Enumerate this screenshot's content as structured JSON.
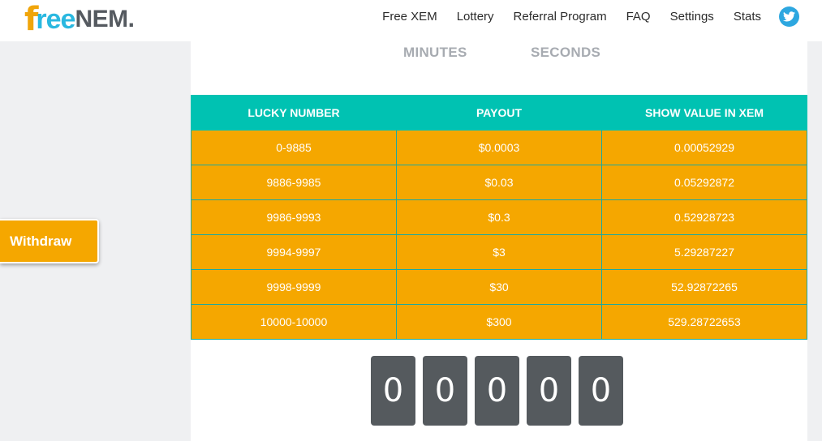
{
  "header": {
    "logo": {
      "f": "f",
      "ree": "ree",
      "nem": "NEM",
      "dot": "."
    },
    "nav": [
      {
        "label": "Free XEM"
      },
      {
        "label": "Lottery"
      },
      {
        "label": "Referral Program"
      },
      {
        "label": "FAQ"
      },
      {
        "label": "Settings"
      },
      {
        "label": "Stats"
      }
    ],
    "social_icon": "twitter-icon"
  },
  "timer": {
    "minutes_label": "MINUTES",
    "seconds_label": "SECONDS"
  },
  "payout_table": {
    "headers": [
      "LUCKY NUMBER",
      "PAYOUT",
      "SHOW VALUE IN XEM"
    ],
    "rows": [
      [
        "0-9885",
        "$0.0003",
        "0.00052929"
      ],
      [
        "9886-9985",
        "$0.03",
        "0.05292872"
      ],
      [
        "9986-9993",
        "$0.3",
        "0.52928723"
      ],
      [
        "9994-9997",
        "$3",
        "5.29287227"
      ],
      [
        "9998-9999",
        "$30",
        "52.92872265"
      ],
      [
        "10000-10000",
        "$300",
        "529.28722653"
      ]
    ]
  },
  "withdraw": {
    "label": "Withdraw"
  },
  "roll_digits": [
    "0",
    "0",
    "0",
    "0",
    "0"
  ],
  "colors": {
    "accent_orange": "#f5a700",
    "accent_teal": "#00c2b2",
    "brand_blue": "#2ab8e0",
    "digit_bg": "#555a5e"
  }
}
